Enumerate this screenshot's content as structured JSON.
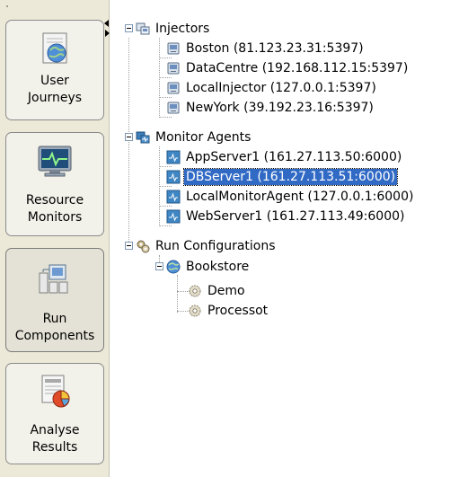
{
  "navigator": {
    "buttons": [
      {
        "label_line1": "User",
        "label_line2": "Journeys",
        "icon": "globe-document-icon"
      },
      {
        "label_line1": "Resource",
        "label_line2": "Monitors",
        "icon": "monitor-pulse-icon"
      },
      {
        "label_line1": "Run",
        "label_line2": "Components",
        "icon": "network-servers-icon"
      },
      {
        "label_line1": "Analyse",
        "label_line2": "Results",
        "icon": "report-pie-icon"
      }
    ]
  },
  "tree": {
    "injectors": {
      "label": "Injectors",
      "items": [
        "Boston (81.123.23.31:5397)",
        "DataCentre (192.168.112.15:5397)",
        "LocalInjector (127.0.0.1:5397)",
        "NewYork (39.192.23.16:5397)"
      ]
    },
    "monitor_agents": {
      "label": "Monitor Agents",
      "items": [
        "AppServer1 (161.27.113.50:6000)",
        "DBServer1 (161.27.113.51:6000)",
        "LocalMonitorAgent (127.0.0.1:6000)",
        "WebServer1 (161.27.113.49:6000)"
      ],
      "selected": "DBServer1 (161.27.113.51:6000)"
    },
    "run_configurations": {
      "label": "Run Configurations",
      "bookstore": {
        "label": "Bookstore",
        "items": [
          "Demo",
          "Processot"
        ]
      }
    }
  },
  "colors": {
    "selection": "#316ac5",
    "nav_background": "#ece9d8"
  }
}
